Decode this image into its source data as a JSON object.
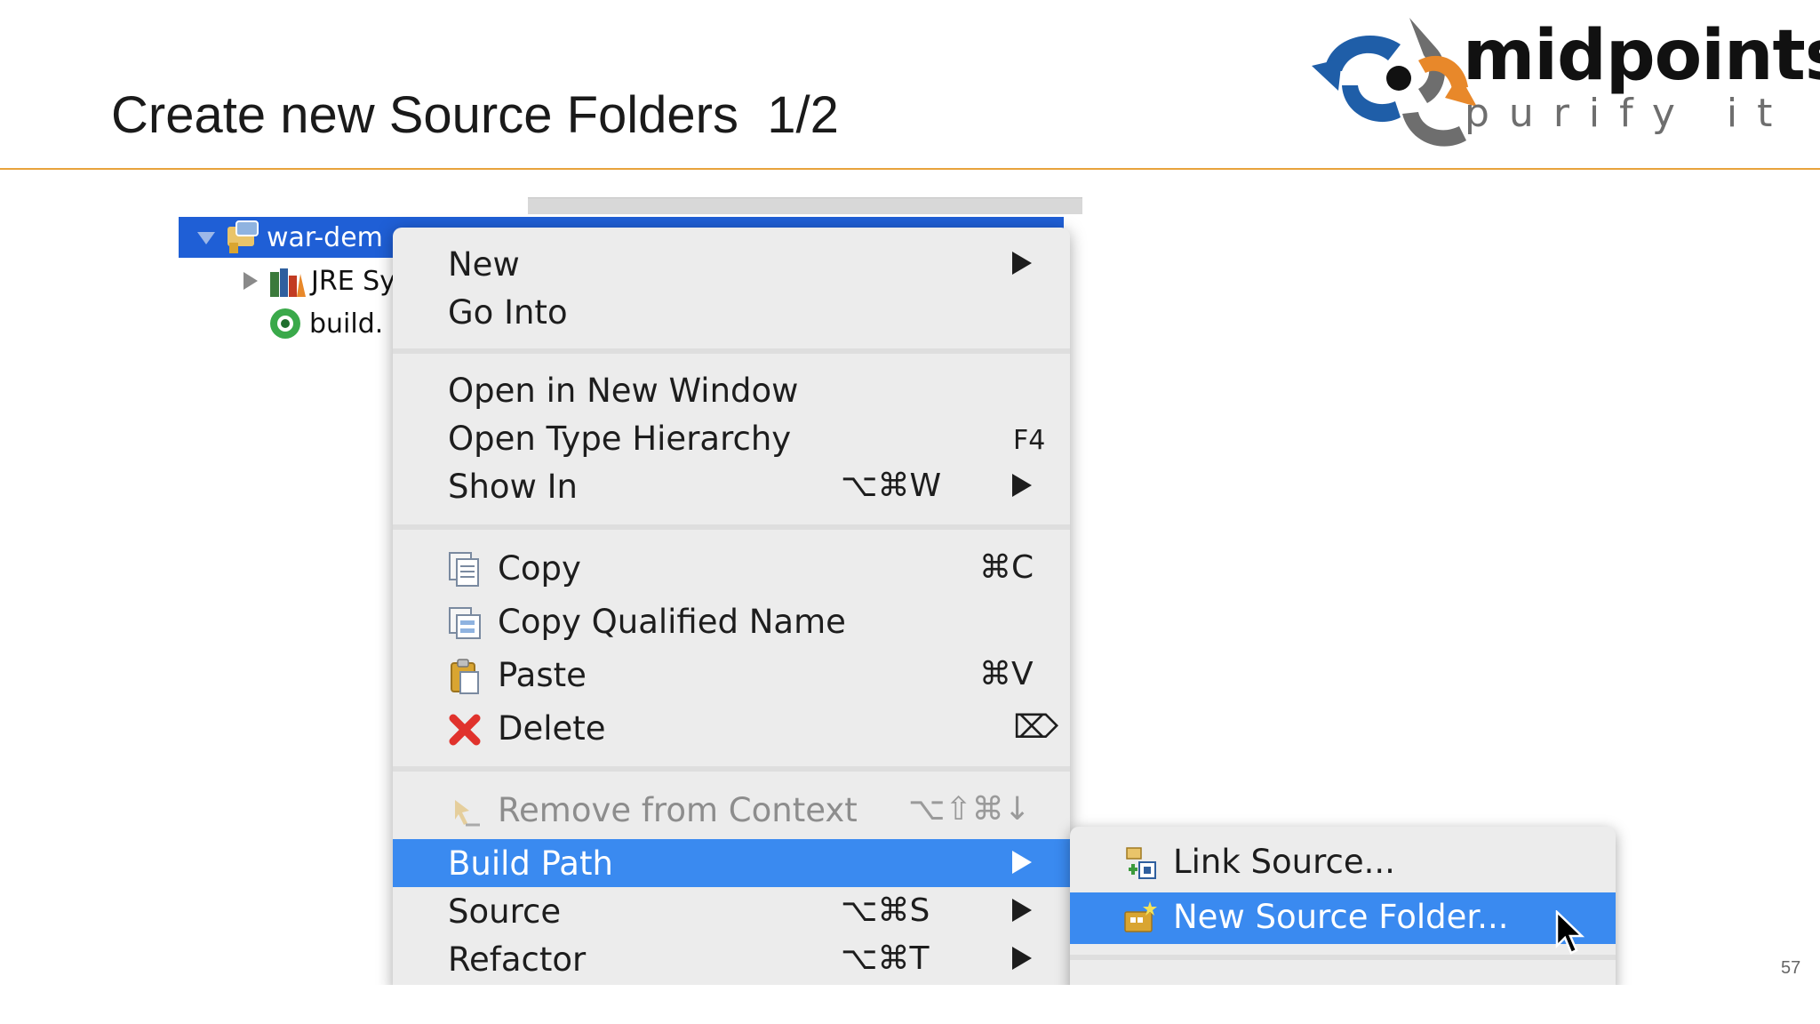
{
  "slide": {
    "title": "Create new Source Folders  1/2",
    "page_number": "57",
    "accent_color": "#e8a33c"
  },
  "logo": {
    "word": "midpoints",
    "tagline": "purify it",
    "colors": {
      "blue": "#1f5ea8",
      "orange": "#e8882a",
      "gray": "#6e6e6e"
    }
  },
  "tree": {
    "project_label": "war-dem",
    "items": [
      {
        "label": "JRE Sy",
        "icon": "library-icon"
      },
      {
        "label": "build.",
        "icon": "build-icon"
      }
    ],
    "selection_color": "#1f5fd6"
  },
  "context_menu": {
    "items": {
      "new": {
        "label": "New",
        "submenu": true
      },
      "go_into": {
        "label": "Go Into"
      },
      "open_new_window": {
        "label": "Open in New Window"
      },
      "open_type_hierarchy": {
        "label": "Open Type Hierarchy",
        "shortcut": "F4"
      },
      "show_in": {
        "label": "Show In",
        "shortcut": "⌥⌘W",
        "submenu": true
      },
      "copy": {
        "label": "Copy",
        "shortcut": "⌘C",
        "icon": "copy-icon"
      },
      "copy_qualified_name": {
        "label": "Copy Qualified Name",
        "icon": "copy-qualified-name-icon"
      },
      "paste": {
        "label": "Paste",
        "shortcut": "⌘V",
        "icon": "paste-icon"
      },
      "delete": {
        "label": "Delete",
        "shortcut": "⌦",
        "icon": "delete-icon"
      },
      "remove_from_context": {
        "label": "Remove from Context",
        "shortcut": "⌥⇧⌘↓",
        "icon": "remove-context-icon",
        "disabled": true
      },
      "build_path": {
        "label": "Build Path",
        "submenu": true,
        "highlighted": true
      },
      "source": {
        "label": "Source",
        "shortcut": "⌥⌘S",
        "submenu": true
      },
      "refactor": {
        "label": "Refactor",
        "shortcut": "⌥⌘T",
        "submenu": true
      }
    },
    "highlight_color": "#3a8af0"
  },
  "build_path_submenu": {
    "items": {
      "link_source": {
        "label": "Link Source...",
        "icon": "link-source-icon"
      },
      "new_source_folder": {
        "label": "New Source Folder...",
        "icon": "new-source-folder-icon",
        "highlighted": true
      }
    }
  }
}
